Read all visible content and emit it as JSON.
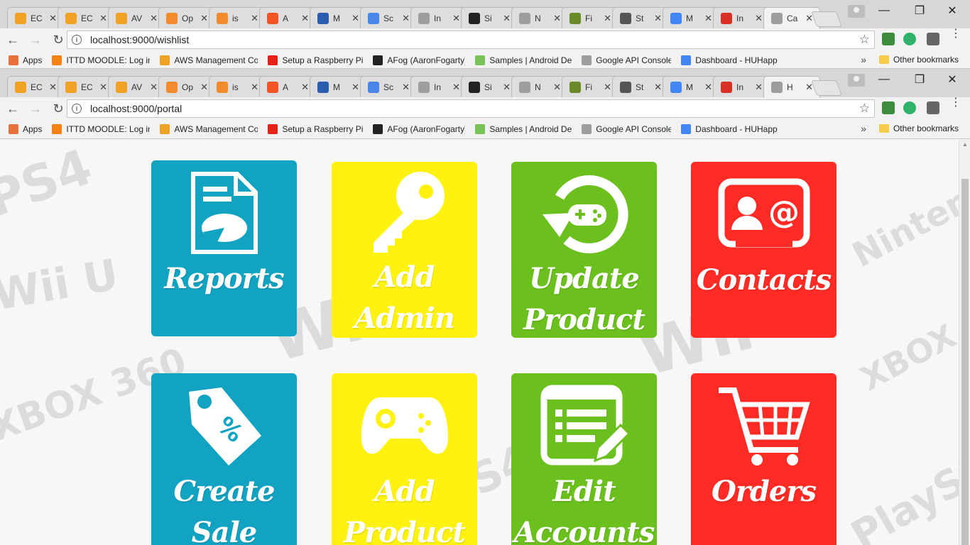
{
  "windows": [
    {
      "tabs": [
        {
          "label": "EC",
          "icon": "aws-box-icon"
        },
        {
          "label": "EC",
          "icon": "aws-box-icon"
        },
        {
          "label": "AV",
          "icon": "aws-box-icon"
        },
        {
          "label": "Op",
          "icon": "postman-icon"
        },
        {
          "label": "is",
          "icon": "postman-icon"
        },
        {
          "label": "A",
          "icon": "microsoft-icon"
        },
        {
          "label": "M",
          "icon": "moodle-m-icon"
        },
        {
          "label": "Sc",
          "icon": "docs-icon"
        },
        {
          "label": "In",
          "icon": "page-icon"
        },
        {
          "label": "Si",
          "icon": "notion-icon"
        },
        {
          "label": "N",
          "icon": "page-icon"
        },
        {
          "label": "Fi",
          "icon": "gear-icon"
        },
        {
          "label": "St",
          "icon": "wikipedia-icon"
        },
        {
          "label": "M",
          "icon": "google-icon"
        },
        {
          "label": "In",
          "icon": "gmail-icon"
        },
        {
          "label": "Ca",
          "icon": "page-icon",
          "active": true
        }
      ],
      "url": "localhost:9000/wishlist"
    },
    {
      "tabs": [
        {
          "label": "EC",
          "icon": "aws-box-icon"
        },
        {
          "label": "EC",
          "icon": "aws-box-icon"
        },
        {
          "label": "AV",
          "icon": "aws-box-icon"
        },
        {
          "label": "Op",
          "icon": "postman-icon"
        },
        {
          "label": "is",
          "icon": "postman-icon"
        },
        {
          "label": "A",
          "icon": "microsoft-icon"
        },
        {
          "label": "M",
          "icon": "moodle-m-icon"
        },
        {
          "label": "Sc",
          "icon": "docs-icon"
        },
        {
          "label": "In",
          "icon": "page-icon"
        },
        {
          "label": "Si",
          "icon": "notion-icon"
        },
        {
          "label": "N",
          "icon": "page-icon"
        },
        {
          "label": "Fi",
          "icon": "gear-icon"
        },
        {
          "label": "St",
          "icon": "wikipedia-icon"
        },
        {
          "label": "M",
          "icon": "google-icon"
        },
        {
          "label": "In",
          "icon": "gmail-icon"
        },
        {
          "label": "H",
          "icon": "page-icon",
          "active": true
        }
      ],
      "url": "localhost:9000/portal"
    }
  ],
  "bookmarks": [
    {
      "label": "Apps",
      "icon": "apps-grid-icon"
    },
    {
      "label": "ITTD MOODLE: Log in",
      "icon": "moodle-icon"
    },
    {
      "label": "AWS Management Co",
      "icon": "aws-box-icon"
    },
    {
      "label": "Setup a Raspberry Pi",
      "icon": "youtube-icon"
    },
    {
      "label": "AFog (AaronFogarty)",
      "icon": "github-icon"
    },
    {
      "label": "Samples | Android De",
      "icon": "android-icon"
    },
    {
      "label": "Google API Console",
      "icon": "page-icon"
    },
    {
      "label": "Dashboard - HUHapp",
      "icon": "google-icon"
    }
  ],
  "bookmarks_more": "»",
  "other_bookmarks": "Other bookmarks",
  "tiles": [
    {
      "label": "Reports",
      "color": "#12a3c2",
      "icon": "report-icon"
    },
    {
      "label": "Add\nAdmin",
      "color": "#fff210",
      "icon": "key-icon"
    },
    {
      "label": "Update\nProduct",
      "color": "#6cc01d",
      "icon": "update-gamepad-icon"
    },
    {
      "label": "Contacts",
      "color": "#ff2b24",
      "icon": "contact-card-icon"
    },
    {
      "label": "Create\nSale",
      "color": "#12a3c2",
      "icon": "price-tag-icon"
    },
    {
      "label": "Add\nProduct",
      "color": "#fff210",
      "icon": "gamepad-icon"
    },
    {
      "label": "Edit\nAccounts",
      "color": "#6cc01d",
      "icon": "edit-list-icon"
    },
    {
      "label": "Orders",
      "color": "#ff2b24",
      "icon": "shopping-cart-icon"
    }
  ],
  "watermarks": [
    "PS4",
    "Wii",
    "Wii U",
    "XBOX 360",
    "Nintendo",
    "PlayStation",
    "XBOX ONE"
  ]
}
